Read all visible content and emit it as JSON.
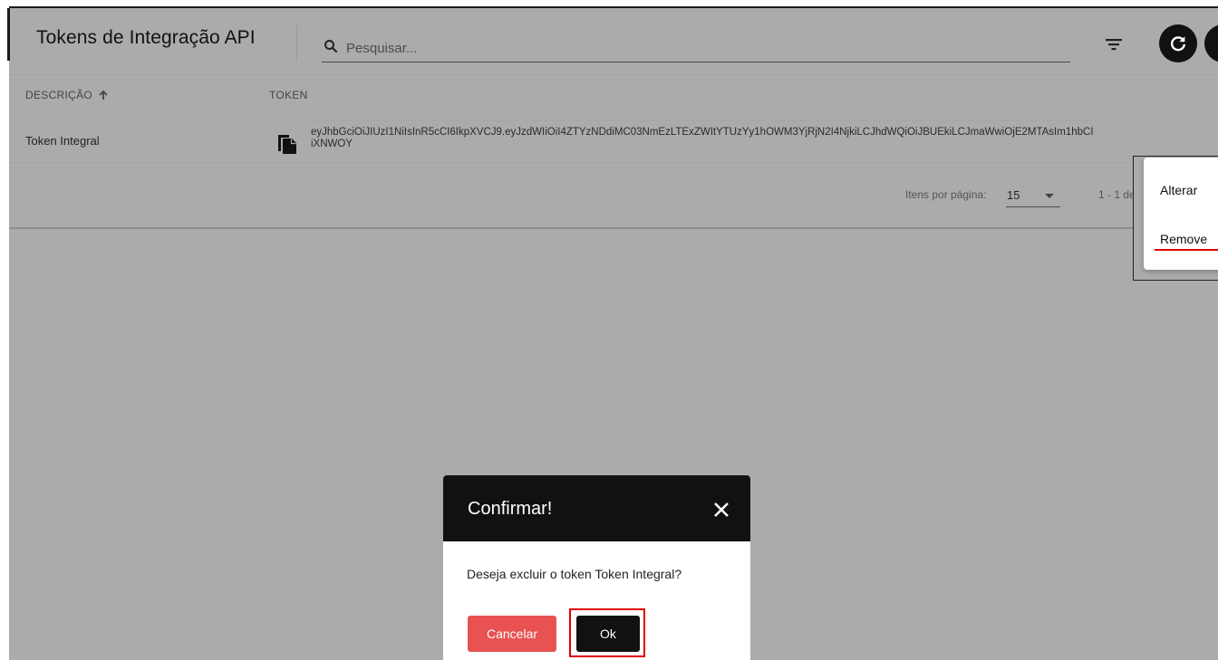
{
  "header": {
    "title": "Tokens de Integração API",
    "search_placeholder": "Pesquisar..."
  },
  "icons": {
    "search": "search-icon",
    "filter": "filter-icon",
    "refresh": "refresh-icon",
    "copy": "copy-icon",
    "close": "close-icon",
    "sort_asc": "arrow-up-icon"
  },
  "table": {
    "columns": [
      "DESCRIÇÃO",
      "TOKEN"
    ],
    "rows": [
      {
        "description": "Token Integral",
        "token_line1": "eyJhbGciOiJIUzI1NiIsInR5cCI6IkpXVCJ9.eyJzdWIiOiI4ZTYzNDdiMC03NmEzLTExZWItYTUzYy1hOWM3YjRjN2I4NjkiLCJhdWQiOiJBUEkiLCJmaWwiOjE2MTAsIm1hbCI",
        "token_line2": "iXNWOY"
      }
    ]
  },
  "pagination": {
    "items_per_page_label": "Itens por página:",
    "page_size": "15",
    "range_text": "1 - 1 de"
  },
  "context_menu": {
    "items": [
      "Alterar",
      "Remove"
    ]
  },
  "dialog": {
    "title": "Confirmar!",
    "message": "Deseja excluir o token Token Integral?",
    "cancel_label": "Cancelar",
    "ok_label": "Ok"
  },
  "colors": {
    "overlay_bg": "#ababab",
    "dialog_header": "#111111",
    "cancel_button": "#e85252",
    "highlight": "#e00000"
  }
}
